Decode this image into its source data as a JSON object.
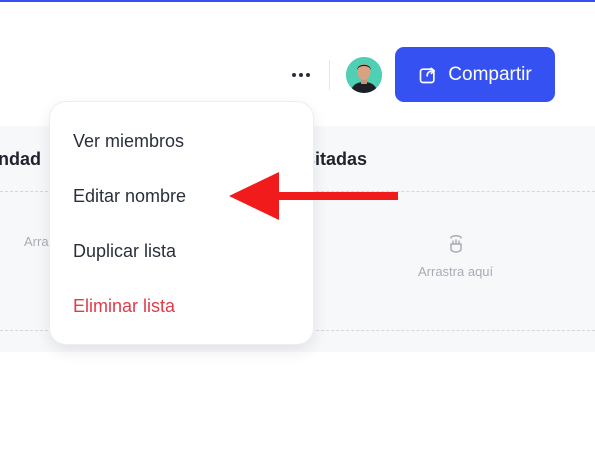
{
  "header": {
    "share_label": "Compartir",
    "more_icon": "more-horizontal-icon",
    "share_icon": "share-icon",
    "avatar": "user-avatar"
  },
  "board": {
    "columns": [
      {
        "title": "ndad",
        "drop_label": "Arra"
      },
      {
        "title": "isitadas",
        "drop_label": "Arrastra aquí"
      }
    ],
    "drop_icon": "drag-hand-icon"
  },
  "menu": {
    "items": [
      {
        "label": "Ver miembros",
        "danger": false
      },
      {
        "label": "Editar nombre",
        "danger": false
      },
      {
        "label": "Duplicar lista",
        "danger": false
      },
      {
        "label": "Eliminar lista",
        "danger": true
      }
    ]
  },
  "annotation": {
    "arrow_color": "#f21b1b",
    "target": "Editar nombre"
  },
  "colors": {
    "primary": "#3551f1",
    "danger": "#e23a48"
  }
}
